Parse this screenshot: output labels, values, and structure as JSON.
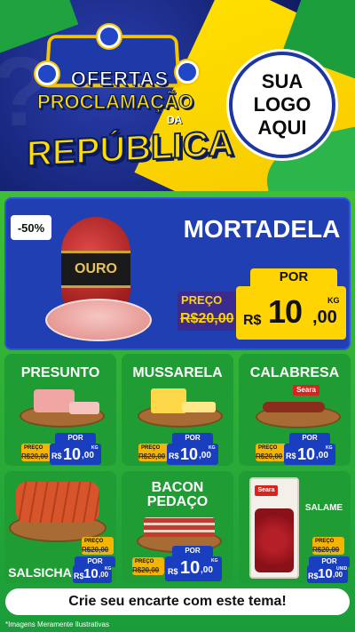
{
  "header": {
    "title_line1": "OFERTAS",
    "title_line2": "PROCLAMAÇÃO",
    "title_da": "DA",
    "title_line3": "REPÚBLICA",
    "logo_lines": [
      "SUA",
      "LOGO",
      "AQUI"
    ]
  },
  "hero": {
    "discount": "-50%",
    "product": "MORTADELA",
    "brand_label": "OURO",
    "por": "POR",
    "preco": "PREÇO",
    "old_price": "R$20,00",
    "currency": "R$",
    "price_int": "10",
    "price_cents": ",00",
    "unit": "KG"
  },
  "products": [
    {
      "name": "PRESUNTO",
      "preco": "PREÇO",
      "old": "R$20,00",
      "por": "POR",
      "currency": "R$",
      "int": "10",
      "cents": ",00",
      "unit": "KG"
    },
    {
      "name": "MUSSARELA",
      "preco": "PREÇO",
      "old": "R$20,00",
      "por": "POR",
      "currency": "R$",
      "int": "10",
      "cents": ",00",
      "unit": "KG"
    },
    {
      "name": "CALABRESA",
      "brand": "Seara",
      "preco": "PREÇO",
      "old": "R$20,00",
      "por": "POR",
      "currency": "R$",
      "int": "10",
      "cents": ",00",
      "unit": "KG"
    },
    {
      "name": "SALSICHA",
      "preco": "PREÇO",
      "old": "R$20,00",
      "por": "POR",
      "currency": "R$",
      "int": "10",
      "cents": ",00",
      "unit": "KG"
    },
    {
      "name_line1": "BACON",
      "name_line2": "PEDAÇO",
      "preco": "PREÇO",
      "old": "R$20,00",
      "por": "POR",
      "currency": "R$",
      "int": "10",
      "cents": ",00",
      "unit": "KG"
    },
    {
      "name": "SALAME",
      "brand": "Seara",
      "preco": "PREÇO",
      "old": "R$20,00",
      "por": "POR",
      "currency": "R$",
      "int": "10",
      "cents": ",00",
      "unit": "UNID"
    }
  ],
  "cta": "Crie seu encarte com este tema!",
  "disclaimer": "*Imagens Meramente Ilustrativas",
  "colors": {
    "green": "#1f9c34",
    "blue": "#1f3fb2",
    "yellow": "#ffd400"
  }
}
